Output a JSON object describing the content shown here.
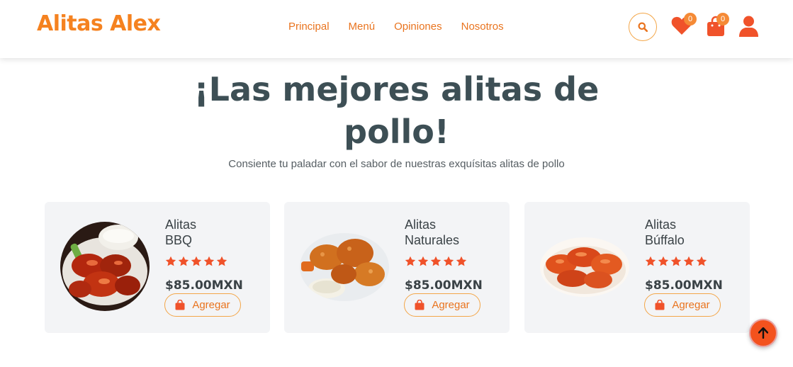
{
  "header": {
    "logo": "Alitas Alex",
    "nav": [
      "Principal",
      "Menú",
      "Opiniones",
      "Nosotros"
    ],
    "favorites_count": "0",
    "cart_count": "0"
  },
  "hero": {
    "title_line1": "¡Las mejores alitas de",
    "title_line2": "pollo!",
    "subtitle": "Consiente tu paladar con el sabor de nuestras exquísitas alitas de pollo"
  },
  "products": [
    {
      "name_line1": "Alitas",
      "name_line2": "BBQ",
      "rating": 5,
      "price": "$85.00MXN",
      "button": "Agregar"
    },
    {
      "name_line1": "Alitas",
      "name_line2": "Naturales",
      "rating": 5,
      "price": "$85.00MXN",
      "button": "Agregar"
    },
    {
      "name_line1": "Alitas",
      "name_line2": "Búffalo",
      "rating": 5,
      "price": "$85.00MXN",
      "button": "Agregar"
    }
  ],
  "colors": {
    "accent": "#f58220",
    "heading": "#3d4f55",
    "card_bg": "#f3f4f6",
    "icon": "#f0522a"
  },
  "icons": [
    "search-icon",
    "heart-icon",
    "shopping-bag-icon",
    "user-icon",
    "star-icon",
    "arrow-up-icon"
  ]
}
